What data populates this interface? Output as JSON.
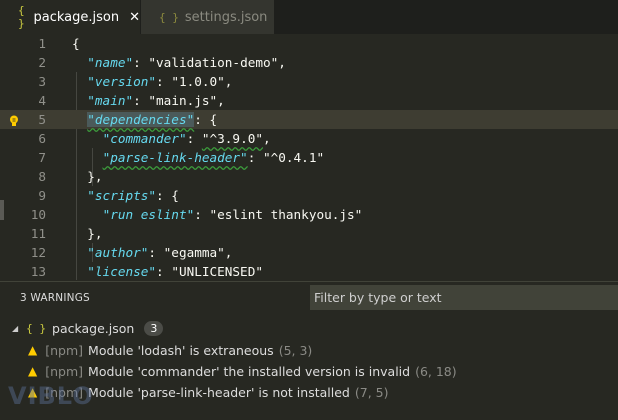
{
  "tabs": [
    {
      "label": "package.json",
      "icon": "json-braces-icon",
      "active": true
    },
    {
      "label": "settings.json",
      "icon": "json-braces-icon",
      "active": false
    }
  ],
  "close_glyph": "✕",
  "icon_glyph": "{ }",
  "editor": {
    "current_line": 5,
    "lines": [
      {
        "n": "1",
        "tokens": [
          {
            "t": "p",
            "v": "{"
          }
        ]
      },
      {
        "n": "2",
        "tokens": [
          {
            "t": "p",
            "v": "  "
          },
          {
            "t": "k",
            "v": "\"name\""
          },
          {
            "t": "p",
            "v": ": "
          },
          {
            "t": "s",
            "v": "\"validation-demo\""
          },
          {
            "t": "p",
            "v": ","
          }
        ]
      },
      {
        "n": "3",
        "tokens": [
          {
            "t": "p",
            "v": "  "
          },
          {
            "t": "k",
            "v": "\"version\""
          },
          {
            "t": "p",
            "v": ": "
          },
          {
            "t": "s",
            "v": "\"1.0.0\""
          },
          {
            "t": "p",
            "v": ","
          }
        ]
      },
      {
        "n": "4",
        "tokens": [
          {
            "t": "p",
            "v": "  "
          },
          {
            "t": "k",
            "v": "\"main\""
          },
          {
            "t": "p",
            "v": ": "
          },
          {
            "t": "s",
            "v": "\"main.js\""
          },
          {
            "t": "p",
            "v": ","
          }
        ]
      },
      {
        "n": "5",
        "tokens": [
          {
            "t": "p",
            "v": "  "
          },
          {
            "t": "k",
            "v": "\"dependencies\"",
            "sq": true,
            "sel": true
          },
          {
            "t": "p",
            "v": ": {"
          }
        ]
      },
      {
        "n": "6",
        "tokens": [
          {
            "t": "p",
            "v": "    "
          },
          {
            "t": "k",
            "v": "\"commander\""
          },
          {
            "t": "p",
            "v": ": "
          },
          {
            "t": "s",
            "v": "\"^3.9.0\"",
            "sq": true
          },
          {
            "t": "p",
            "v": ","
          }
        ]
      },
      {
        "n": "7",
        "tokens": [
          {
            "t": "p",
            "v": "    "
          },
          {
            "t": "k",
            "v": "\"parse-link-header\"",
            "sq": true
          },
          {
            "t": "p",
            "v": ": "
          },
          {
            "t": "s",
            "v": "\"^0.4.1\""
          }
        ]
      },
      {
        "n": "8",
        "tokens": [
          {
            "t": "p",
            "v": "  },"
          }
        ]
      },
      {
        "n": "9",
        "tokens": [
          {
            "t": "p",
            "v": "  "
          },
          {
            "t": "k",
            "v": "\"scripts\""
          },
          {
            "t": "p",
            "v": ": {"
          }
        ]
      },
      {
        "n": "10",
        "tokens": [
          {
            "t": "p",
            "v": "    "
          },
          {
            "t": "k",
            "v": "\"run eslint\""
          },
          {
            "t": "p",
            "v": ": "
          },
          {
            "t": "s",
            "v": "\"eslint thankyou.js\""
          }
        ]
      },
      {
        "n": "11",
        "tokens": [
          {
            "t": "p",
            "v": "  },"
          }
        ]
      },
      {
        "n": "12",
        "tokens": [
          {
            "t": "p",
            "v": "  "
          },
          {
            "t": "k",
            "v": "\"author\""
          },
          {
            "t": "p",
            "v": ": "
          },
          {
            "t": "s",
            "v": "\"egamma\""
          },
          {
            "t": "p",
            "v": ","
          }
        ]
      },
      {
        "n": "13",
        "tokens": [
          {
            "t": "p",
            "v": "  "
          },
          {
            "t": "k",
            "v": "\"license\""
          },
          {
            "t": "p",
            "v": ": "
          },
          {
            "t": "s",
            "v": "\"UNLICENSED\""
          }
        ]
      }
    ]
  },
  "panel": {
    "title": "3 WARNINGS",
    "filter_placeholder": "Filter by type or text",
    "file": {
      "name": "package.json",
      "count": "3"
    },
    "warnings": [
      {
        "source": "[npm]",
        "message": "Module 'lodash' is extraneous",
        "location": "(5, 3)"
      },
      {
        "source": "[npm]",
        "message": "Module 'commander' the installed version is invalid",
        "location": "(6, 18)"
      },
      {
        "source": "[npm]",
        "message": "Module 'parse-link-header' is not installed",
        "location": "(7, 5)"
      }
    ]
  },
  "watermark": "VIBLO",
  "colors": {
    "background": "#272822",
    "key": "#66d9ef",
    "string": "#f8f8f2",
    "warning": "#ffcc00",
    "squiggle": "#3c9d3c"
  }
}
